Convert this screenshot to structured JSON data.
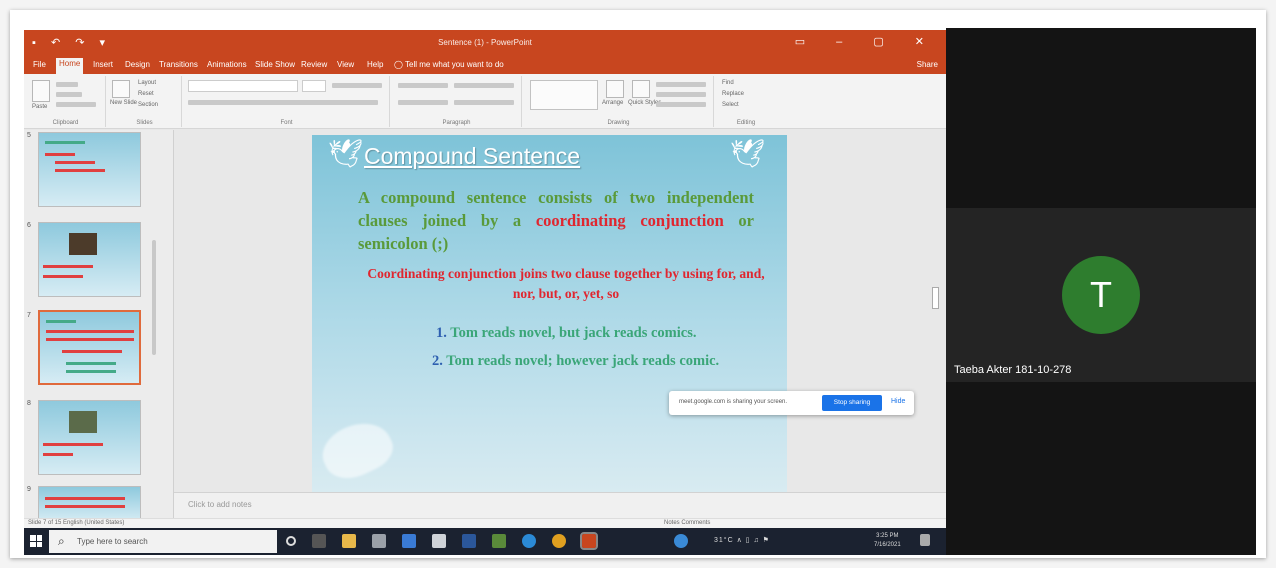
{
  "powerpoint": {
    "title": "Sentence (1) - PowerPoint",
    "tabs": [
      "File",
      "Home",
      "Insert",
      "Design",
      "Transitions",
      "Animations",
      "Slide Show",
      "Review",
      "View",
      "Help"
    ],
    "active_tab": "Home",
    "tell_me": "Tell me what you want to do",
    "share": "Share",
    "ribbon_groups": [
      "Clipboard",
      "Slides",
      "Font",
      "Paragraph",
      "Drawing",
      "Editing"
    ],
    "ribbon_labels": {
      "paste": "Paste",
      "new_slide": "New Slide",
      "layout": "Layout",
      "reset": "Reset",
      "section": "Section",
      "arrange": "Arrange",
      "quick_styles": "Quick Styles",
      "find": "Find",
      "replace": "Replace",
      "select": "Select"
    },
    "slide_numbers": [
      "5",
      "6",
      "7",
      "8",
      "9"
    ],
    "notes_placeholder": "Click to add notes",
    "status_left": "Slide 7 of 15   English (United States)",
    "status_right": "Notes   Comments"
  },
  "slide": {
    "title": "Compound Sentence",
    "definition_pre": "A compound sentence consists of two independent clauses joined by a ",
    "definition_red": "coordinating conjunction",
    "definition_post": " or semicolon (;)",
    "coordinating_note": "Coordinating conjunction joins two clause together by using for, and, nor, but, or, yet, so",
    "examples": [
      {
        "num": "1.",
        "text": "Tom reads novel, but jack reads comics."
      },
      {
        "num": "2.",
        "text": "Tom reads novel; however jack reads comic."
      }
    ]
  },
  "sharing_bar": {
    "message": "meet.google.com is sharing your screen.",
    "stop_label": "Stop sharing",
    "hide_label": "Hide"
  },
  "taskbar": {
    "search_placeholder": "Type here to search",
    "temperature": "31°C",
    "time": "3:25 PM",
    "date": "7/16/2021"
  },
  "participant": {
    "initial": "T",
    "name": "Taeba Akter 181-10-278"
  },
  "colors": {
    "ppt_accent": "#c8461f",
    "slide_red": "#e0262f",
    "slide_green": "#5a9a3a",
    "avatar": "#2e7d2e",
    "stop_button": "#1a73e8"
  }
}
